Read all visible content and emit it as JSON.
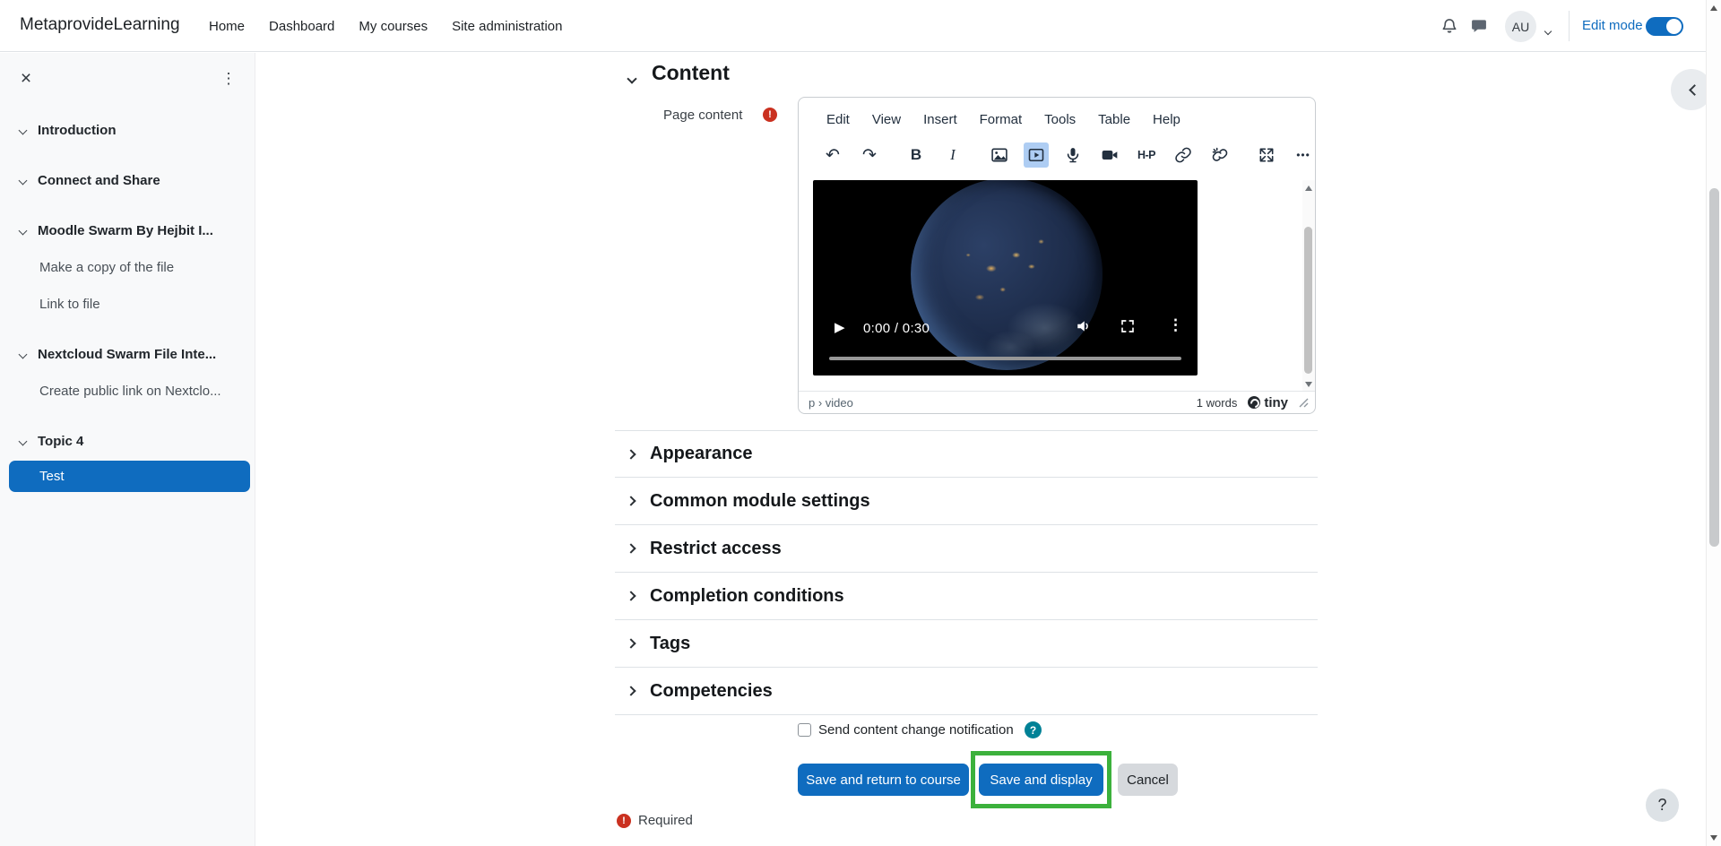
{
  "navbar": {
    "brand": "MetaprovideLearning",
    "links": [
      {
        "label": "Home"
      },
      {
        "label": "Dashboard"
      },
      {
        "label": "My courses"
      },
      {
        "label": "Site administration"
      }
    ],
    "user_initials": "AU",
    "edit_mode_label": "Edit mode"
  },
  "sidebar": {
    "close_glyph": "×",
    "kebab_glyph": "⋮",
    "items": [
      {
        "label": "Introduction",
        "type": "section"
      },
      {
        "label": "Connect and Share",
        "type": "section"
      },
      {
        "label": "Moodle Swarm By Hejbit I...",
        "type": "section"
      },
      {
        "label": "Make a copy of the file",
        "type": "link"
      },
      {
        "label": "Link to file",
        "type": "link"
      },
      {
        "label": "Nextcloud Swarm File Inte...",
        "type": "section"
      },
      {
        "label": "Create public link on Nextclo...",
        "type": "link"
      },
      {
        "label": "Topic 4",
        "type": "section"
      },
      {
        "label": "Test",
        "type": "link",
        "active": true
      }
    ]
  },
  "content": {
    "section_title": "Content",
    "field_label": "Page content",
    "required_mark": "!",
    "editor": {
      "menu": [
        "Edit",
        "View",
        "Insert",
        "Format",
        "Tools",
        "Table",
        "Help"
      ],
      "glyphs": {
        "undo": "↶",
        "redo": "↷",
        "bold": "B",
        "italic": "I",
        "h5p": "H-P",
        "more": "•••"
      },
      "video": {
        "time": "0:00 / 0:30",
        "kebab_glyph": "⋮",
        "play_glyph": "▶"
      },
      "statusbar": {
        "path": "p › video",
        "wordcount": "1 words",
        "brand": "tiny"
      }
    },
    "sections": [
      "Appearance",
      "Common module settings",
      "Restrict access",
      "Completion conditions",
      "Tags",
      "Competencies"
    ],
    "notification_label": "Send content change notification",
    "help_glyph": "?",
    "buttons": {
      "save_return": "Save and return to course",
      "save_display": "Save and display",
      "cancel": "Cancel"
    },
    "required_label": "Required"
  },
  "colors": {
    "primary": "#0f6cbf",
    "highlight_green": "#3cb13c",
    "info_teal": "#008196",
    "required_red": "#ca3120",
    "active_toolbar_bg": "#aecdf3"
  }
}
